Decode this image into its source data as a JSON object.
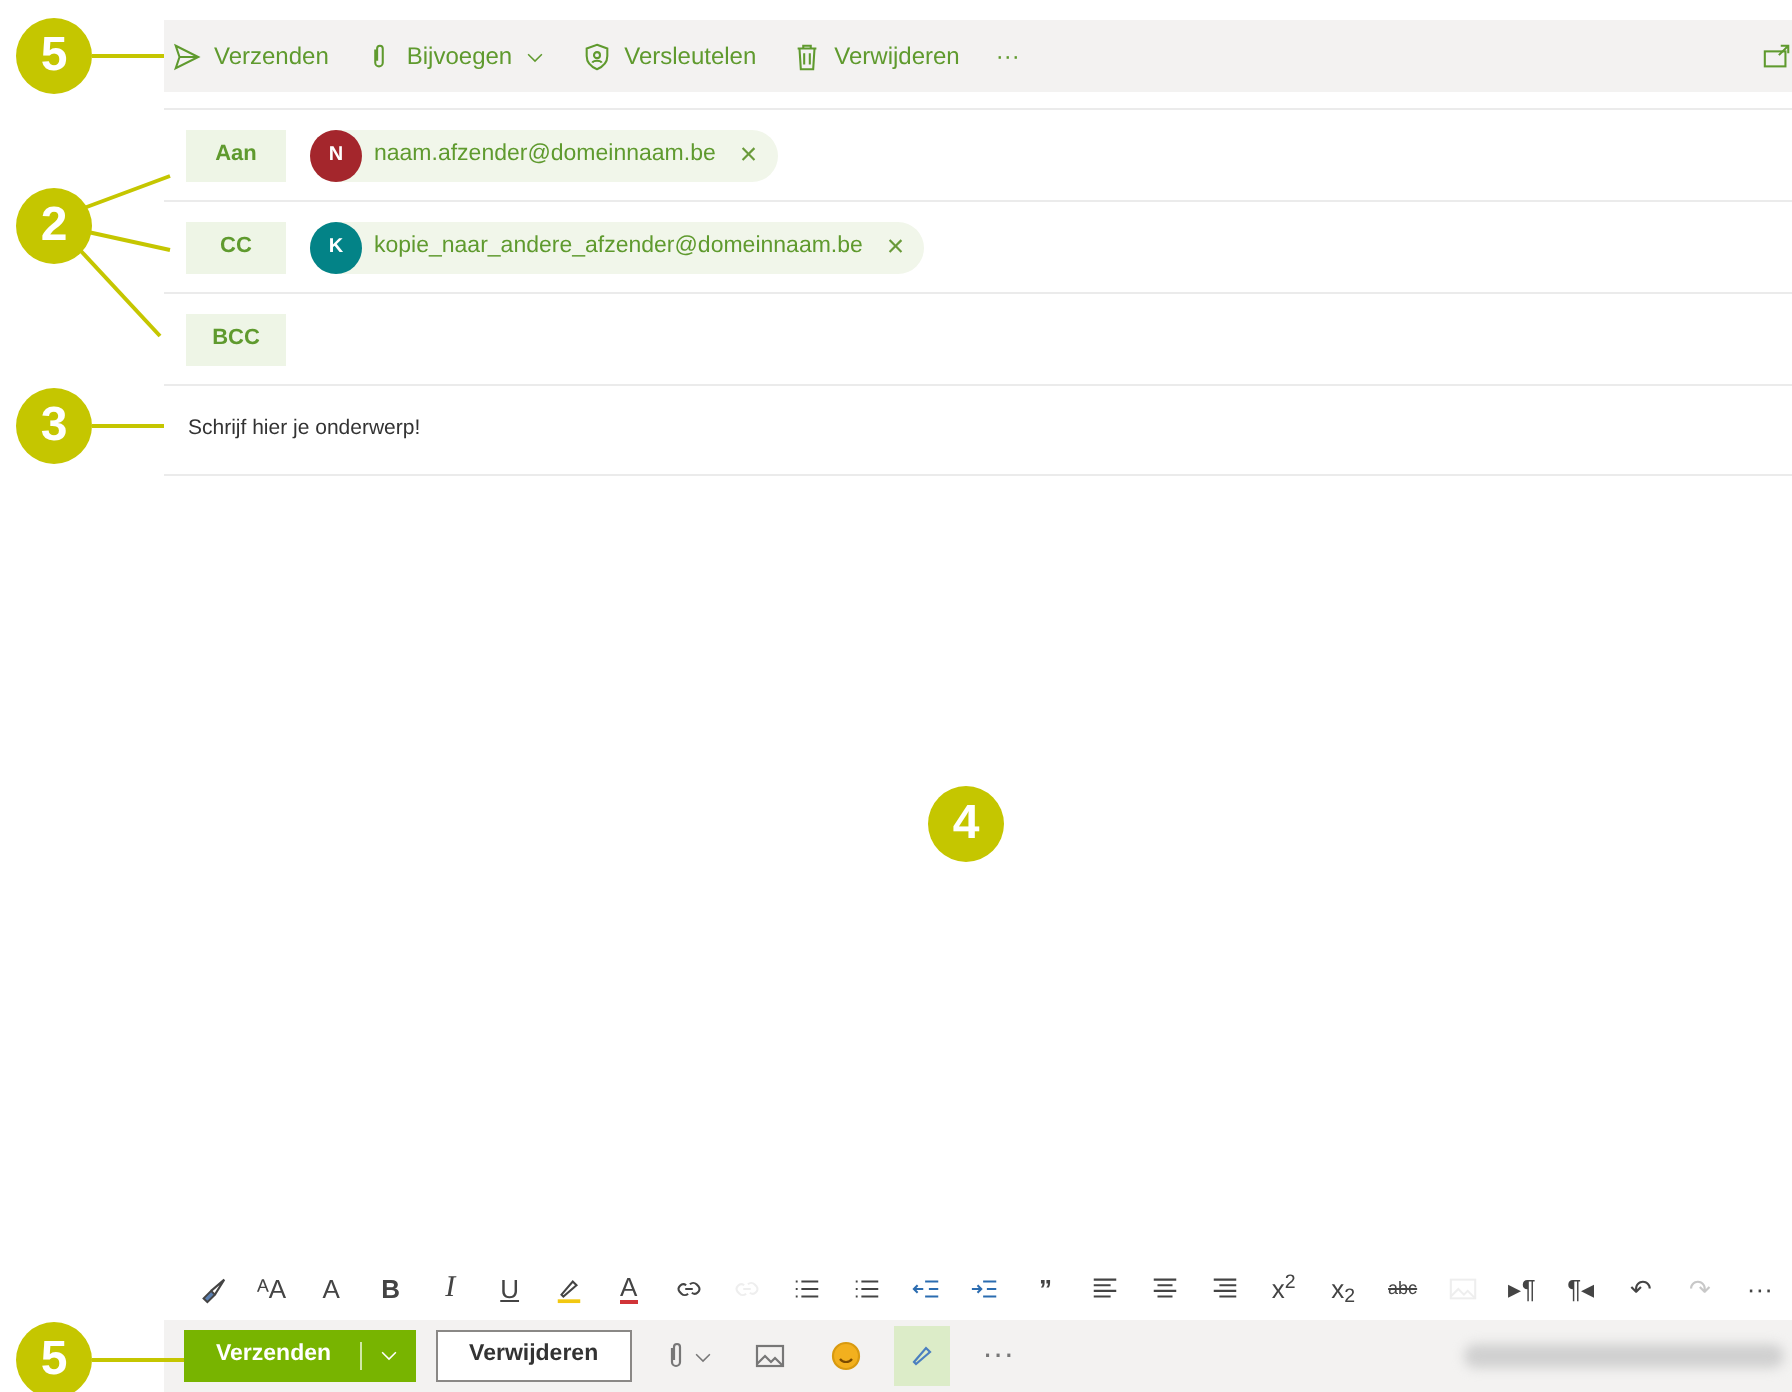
{
  "top_toolbar": {
    "items": [
      {
        "kind": "send",
        "label": "Verzenden"
      },
      {
        "kind": "attach",
        "label": "Bijvoegen"
      },
      {
        "kind": "shield",
        "label": "Versleutelen"
      },
      {
        "kind": "trash",
        "label": "Verwijderen"
      },
      {
        "kind": "more",
        "label": "···"
      }
    ]
  },
  "recipients": [
    {
      "label": "Aan",
      "chips": [
        {
          "initial": "N",
          "color": "#a4262c",
          "email": "naam.afzender@domeinnaam.be",
          "remove": "×"
        }
      ]
    },
    {
      "label": "CC",
      "chips": [
        {
          "initial": "K",
          "color": "#038387",
          "email": "kopie_naar_andere_afzender@domeinnaam.be",
          "remove": "×"
        }
      ]
    },
    {
      "label": "BCC"
    }
  ],
  "subject": {
    "value": "Schrijf hier je onderwerp!"
  },
  "format_toolbar": [
    {
      "kind": "brush",
      "disabled": false
    },
    {
      "kind": "glyph",
      "glyph": "ᴬA",
      "disabled": false
    },
    {
      "kind": "glyph",
      "glyph": "A",
      "disabled": false
    },
    {
      "kind": "bold",
      "glyph": "B",
      "disabled": false
    },
    {
      "kind": "italic",
      "glyph": "I",
      "disabled": false
    },
    {
      "kind": "underline",
      "glyph": "U",
      "disabled": false
    },
    {
      "kind": "highlight",
      "disabled": false
    },
    {
      "kind": "fontcolor",
      "glyph": "A",
      "disabled": false
    },
    {
      "kind": "link",
      "disabled": false
    },
    {
      "kind": "link",
      "disabled": true
    },
    {
      "kind": "lines",
      "disabled": false
    },
    {
      "kind": "lines",
      "disabled": false
    },
    {
      "kind": "outdent",
      "disabled": false
    },
    {
      "kind": "indent",
      "disabled": false
    },
    {
      "kind": "bold",
      "glyph": "”",
      "disabled": false
    },
    {
      "kind": "align-left",
      "disabled": false
    },
    {
      "kind": "align-center",
      "disabled": false
    },
    {
      "kind": "align-right",
      "disabled": false
    },
    {
      "kind": "glyph",
      "glyph": "x$^{2}$",
      "disabled": false
    },
    {
      "kind": "glyph",
      "glyph": "x$_{2}$",
      "disabled": false
    },
    {
      "kind": "strike",
      "glyph": "abc",
      "disabled": false
    },
    {
      "kind": "image",
      "disabled": true
    },
    {
      "kind": "glyph",
      "glyph": "▸¶",
      "disabled": false
    },
    {
      "kind": "glyph",
      "glyph": "¶◂",
      "disabled": false
    },
    {
      "kind": "glyph",
      "glyph": "↶",
      "disabled": false
    },
    {
      "kind": "glyph",
      "glyph": "↷",
      "disabled": true
    },
    {
      "kind": "glyph",
      "glyph": "···",
      "disabled": false
    }
  ],
  "bottom_bar": {
    "send_button": "Verzenden",
    "discard_button": "Verwijderen",
    "tools": [
      {
        "kind": "attach",
        "selected": false
      },
      {
        "kind": "image",
        "selected": false
      },
      {
        "kind": "emoji",
        "selected": false
      },
      {
        "kind": "editor",
        "selected": true
      },
      {
        "kind": "more",
        "label": "···",
        "selected": false
      }
    ]
  },
  "callouts": [
    {
      "number": "5"
    },
    {
      "number": "2"
    },
    {
      "number": "3"
    },
    {
      "number": "4"
    },
    {
      "number": "5"
    }
  ]
}
